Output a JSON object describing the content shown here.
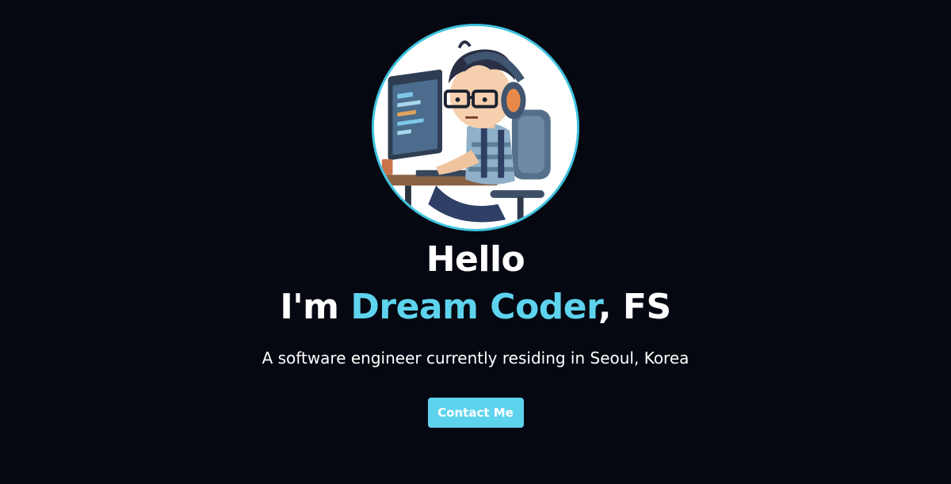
{
  "home": {
    "avatar": {
      "icon": "developer-avatar-illustration",
      "border_color": "#3fc3e0"
    },
    "title": {
      "line1": "Hello",
      "prefix": "I'm ",
      "name": "Dream Coder",
      "suffix": ", FS"
    },
    "description": "A software engineer currently residing in Seoul, Korea",
    "contact_button": "Contact Me"
  },
  "colors": {
    "background": "#050811",
    "accent": "#5ed3ee",
    "text": "#ffffff"
  }
}
